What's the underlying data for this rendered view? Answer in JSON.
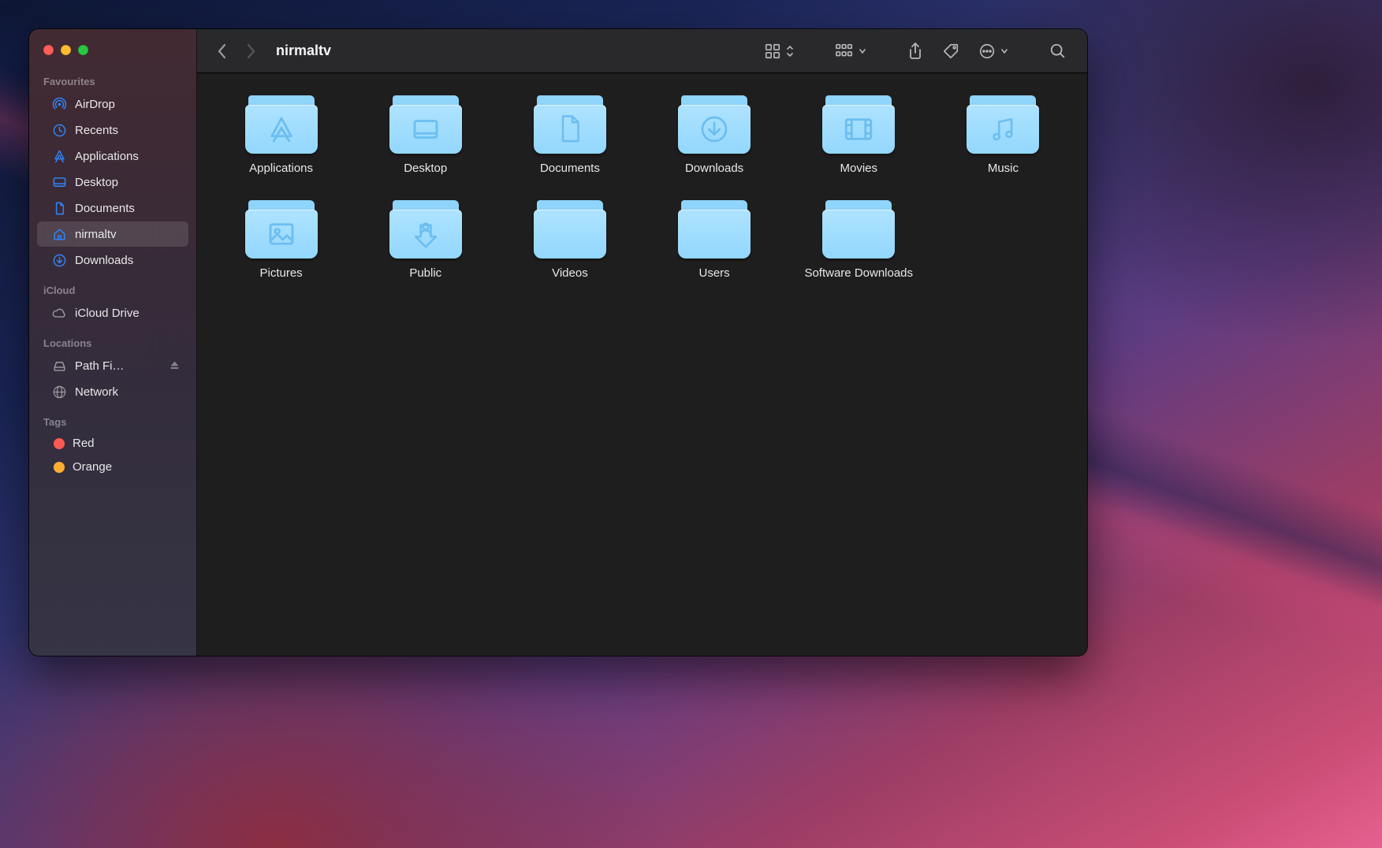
{
  "window": {
    "title": "nirmaltv"
  },
  "sidebar": {
    "sections": [
      {
        "label": "Favourites",
        "items": [
          {
            "icon": "airdrop",
            "label": "AirDrop"
          },
          {
            "icon": "clock",
            "label": "Recents"
          },
          {
            "icon": "apps",
            "label": "Applications"
          },
          {
            "icon": "desktop",
            "label": "Desktop"
          },
          {
            "icon": "doc",
            "label": "Documents"
          },
          {
            "icon": "home",
            "label": "nirmaltv",
            "selected": true
          },
          {
            "icon": "download",
            "label": "Downloads"
          }
        ]
      },
      {
        "label": "iCloud",
        "items": [
          {
            "icon": "cloud",
            "label": "iCloud Drive"
          }
        ]
      },
      {
        "label": "Locations",
        "items": [
          {
            "icon": "disk",
            "label": "Path Fi…",
            "eject": true
          },
          {
            "icon": "network",
            "label": "Network"
          }
        ]
      },
      {
        "label": "Tags",
        "items": [
          {
            "tag": "#ff5a52",
            "label": "Red"
          },
          {
            "tag": "#ffae33",
            "label": "Orange"
          }
        ]
      }
    ]
  },
  "folders": [
    {
      "label": "Applications",
      "glyph": "apps"
    },
    {
      "label": "Desktop",
      "glyph": "desktop"
    },
    {
      "label": "Documents",
      "glyph": "doc"
    },
    {
      "label": "Downloads",
      "glyph": "download"
    },
    {
      "label": "Movies",
      "glyph": "movie"
    },
    {
      "label": "Music",
      "glyph": "music"
    },
    {
      "label": "Pictures",
      "glyph": "picture"
    },
    {
      "label": "Public",
      "glyph": "public"
    },
    {
      "label": "Videos",
      "glyph": ""
    },
    {
      "label": "Users",
      "glyph": ""
    },
    {
      "label": "Software Downloads",
      "glyph": ""
    }
  ],
  "toolbar": {
    "view_label": "Icon view",
    "group_label": "Group",
    "share_label": "Share",
    "tags_label": "Edit tags",
    "more_label": "More",
    "search_label": "Search"
  }
}
